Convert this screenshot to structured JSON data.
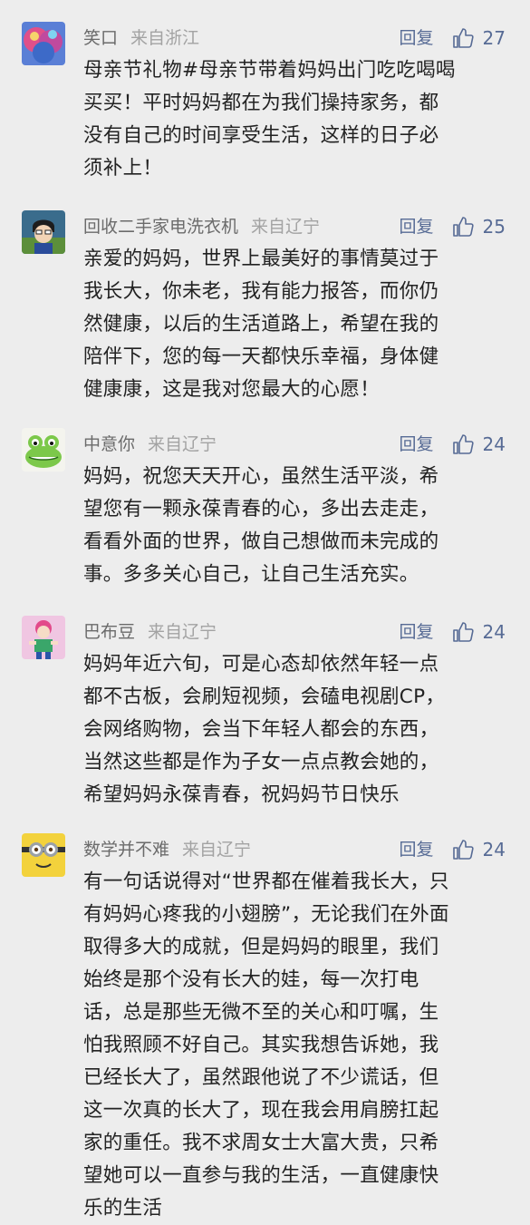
{
  "accent": "#576b95",
  "comments": [
    {
      "user": "笑口",
      "location": "来自浙江",
      "reply": "回复",
      "likes": "27",
      "avatar": "colorful-art-avatar",
      "lines": [
        "母亲节礼物#母亲节带着妈妈出门吃吃喝喝",
        "买买！平时妈妈都在为我们操持家务，都",
        "没有自己的时间享受生活，这样的日子必",
        "须补上！"
      ]
    },
    {
      "user": "回收二手家电洗衣机",
      "location": "来自辽宁",
      "reply": "回复",
      "likes": "25",
      "avatar": "anime-boy-avatar",
      "lines": [
        "亲爱的妈妈，世界上最美好的事情莫过于",
        "我长大，你未老，我有能力报答，而你仍",
        "然健康，以后的生活道路上，希望在我的",
        "陪伴下，您的每一天都快乐幸福，身体健",
        "健康康，这是我对您最大的心愿！"
      ]
    },
    {
      "user": "中意你",
      "location": "来自辽宁",
      "reply": "回复",
      "likes": "24",
      "avatar": "green-frog-avatar",
      "lines": [
        "妈妈，祝您天天开心，虽然生活平淡，希",
        "望您有一颗永葆青春的心，多出去走走，",
        "看看外面的世界，做自己想做而未完成的",
        "事。多多关心自己，让自己生活充实。"
      ]
    },
    {
      "user": "巴布豆",
      "location": "来自辽宁",
      "reply": "回复",
      "likes": "24",
      "avatar": "cartoon-character-avatar",
      "lines": [
        "妈妈年近六旬，可是心态却依然年轻一点",
        "都不古板，会刷短视频，会磕电视剧CP，",
        "会网络购物，会当下年轻人都会的东西，",
        "当然这些都是作为子女一点点教会她的，",
        "希望妈妈永葆青春，祝妈妈节日快乐"
      ]
    },
    {
      "user": "数学并不难",
      "location": "来自辽宁",
      "reply": "回复",
      "likes": "24",
      "avatar": "minion-avatar",
      "lines": [
        "有一句话说得对“世界都在催着我长大，只",
        "有妈妈心疼我的小翅膀”，无论我们在外面",
        "取得多大的成就，但是妈妈的眼里，我们",
        "始终是那个没有长大的娃，每一次打电",
        "话，总是那些无微不至的关心和叮嘱，生",
        "怕我照顾不好自己。其实我想告诉她，我",
        "已经长大了，虽然跟他说了不少谎话，但",
        "这一次真的长大了，现在我会用肩膀扛起",
        "家的重任。我不求周女士大富大贵，只希",
        "望她可以一直参与我的生活，一直健康快",
        "乐的生活"
      ]
    }
  ]
}
